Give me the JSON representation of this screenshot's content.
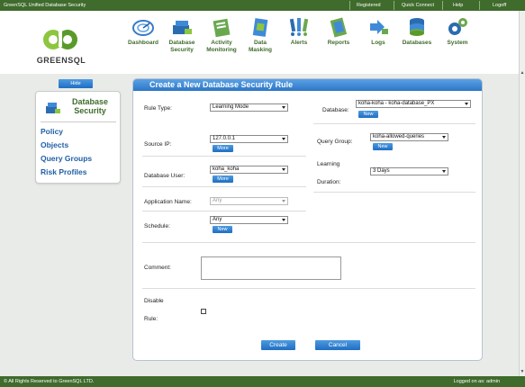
{
  "topbar": {
    "app_title": "GreenSQL Unified Database Security",
    "links": [
      "Registered",
      "Quick Connect",
      "Help",
      "Logoff"
    ]
  },
  "logo": {
    "text": "GREENSQL"
  },
  "nav": [
    {
      "label": "Dashboard",
      "icon": "dashboard-icon"
    },
    {
      "label": "Database\nSecurity",
      "icon": "database-security-icon"
    },
    {
      "label": "Activity\nMonitoring",
      "icon": "activity-monitoring-icon"
    },
    {
      "label": "Data\nMasking",
      "icon": "data-masking-icon"
    },
    {
      "label": "Alerts",
      "icon": "alerts-icon"
    },
    {
      "label": "Reports",
      "icon": "reports-icon"
    },
    {
      "label": "Logs",
      "icon": "logs-icon"
    },
    {
      "label": "Databases",
      "icon": "databases-icon"
    },
    {
      "label": "System",
      "icon": "system-gears-icon"
    }
  ],
  "sidebar": {
    "hide_label": "Hide",
    "heading": "Database Security",
    "items": [
      "Policy",
      "Objects",
      "Query Groups",
      "Risk Profiles"
    ]
  },
  "form": {
    "title": "Create a New Database Security Rule",
    "rule_type": {
      "label": "Rule Type:",
      "value": "Learning Mode"
    },
    "database": {
      "label": "Database:",
      "value": "koha-koha - koha-database_PX",
      "new_label": "New"
    },
    "source_ip": {
      "label": "Source IP:",
      "value": "127.0.0.1",
      "more_label": "More"
    },
    "query_group": {
      "label": "Query Group:",
      "value": "koha-allowed-queries",
      "new_label": "New"
    },
    "database_user": {
      "label": "Database User:",
      "value": "koha_koha",
      "more_label": "More"
    },
    "learning_duration": {
      "label_line1": "Learning",
      "label_line2": "Duration:",
      "value": "3 Days"
    },
    "application_name": {
      "label": "Application Name:",
      "value": "Any"
    },
    "schedule": {
      "label": "Schedule:",
      "value": "Any",
      "new_label": "New"
    },
    "comment": {
      "label": "Comment:",
      "value": ""
    },
    "disable_rule": {
      "label_line1": "Disable",
      "label_line2": "Rule:",
      "checked": false
    },
    "create_label": "Create",
    "cancel_label": "Cancel"
  },
  "footer": {
    "copyright": "© All Rights Reserved to GreenSQL LTD.",
    "logged_on": "Logged on as: admin"
  },
  "colors": {
    "brand_green": "#3f6b2c",
    "accent_blue": "#2c76c5",
    "link_blue": "#1f5fa5"
  }
}
